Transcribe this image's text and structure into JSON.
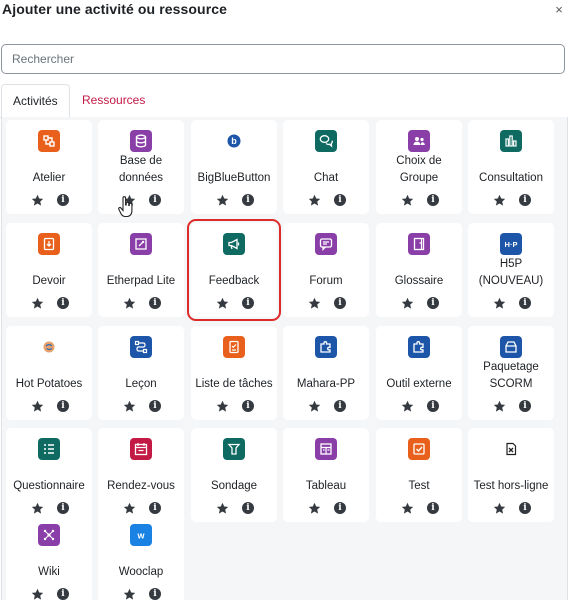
{
  "dialog": {
    "title": "Ajouter une activité ou ressource",
    "close_glyph": "×"
  },
  "search": {
    "placeholder": "Rechercher",
    "value": ""
  },
  "tabs": [
    {
      "label": "Activités",
      "active": true
    },
    {
      "label": "Ressources",
      "active": false
    }
  ],
  "colors": {
    "collaboration": "#f7634d",
    "communication": "#11a676",
    "assessment": "#eb66a2",
    "content": "#399be2",
    "interactive": "#7a5ae6",
    "teal": "#0d5d6f",
    "purple": "#8d3ab1",
    "blue": "#1a5bb3",
    "orange": "#e85a1d",
    "crimson": "#c31a45"
  },
  "activities": [
    {
      "name": "Atelier",
      "icon": "workshop-icon",
      "color": "#e8601c"
    },
    {
      "name": "Base de données",
      "icon": "database-icon",
      "color": "#8a3fa8"
    },
    {
      "name": "BigBlueButton",
      "icon": "bigbluebutton-icon",
      "color": "#1d56a8"
    },
    {
      "name": "Chat",
      "icon": "chat-icon",
      "color": "#0f6a62"
    },
    {
      "name": "Choix de Groupe",
      "icon": "group-choice-icon",
      "color": "#8a3fa8"
    },
    {
      "name": "Consultation",
      "icon": "poll-chart-icon",
      "color": "#0f6a62"
    },
    {
      "name": "Devoir",
      "icon": "assignment-icon",
      "color": "#e8601c"
    },
    {
      "name": "Etherpad Lite",
      "icon": "etherpad-icon",
      "color": "#8a3fa8"
    },
    {
      "name": "Feedback",
      "icon": "megaphone-icon",
      "color": "#0f6a62"
    },
    {
      "name": "Forum",
      "icon": "forum-icon",
      "color": "#8a3fa8"
    },
    {
      "name": "Glossaire",
      "icon": "glossary-icon",
      "color": "#8a3fa8"
    },
    {
      "name": "H5P (NOUVEAU)",
      "icon": "h5p-icon",
      "color": "#1d56a8"
    },
    {
      "name": "Hot Potatoes",
      "icon": "hot-potatoes-icon",
      "color": "#ffffff"
    },
    {
      "name": "Leçon",
      "icon": "lesson-icon",
      "color": "#1d56a8"
    },
    {
      "name": "Liste de tâches",
      "icon": "checklist-icon",
      "color": "#e8601c"
    },
    {
      "name": "Mahara-PP",
      "icon": "puzzle-icon",
      "color": "#1d56a8"
    },
    {
      "name": "Outil externe",
      "icon": "external-tool-icon",
      "color": "#1d56a8"
    },
    {
      "name": "Paquetage SCORM",
      "icon": "scorm-package-icon",
      "color": "#1d56a8"
    },
    {
      "name": "Questionnaire",
      "icon": "questionnaire-icon",
      "color": "#0f6a62"
    },
    {
      "name": "Rendez-vous",
      "icon": "scheduler-icon",
      "color": "#c31a45"
    },
    {
      "name": "Sondage",
      "icon": "survey-icon",
      "color": "#0f6a62"
    },
    {
      "name": "Tableau",
      "icon": "board-icon",
      "color": "#8a3fa8"
    },
    {
      "name": "Test",
      "icon": "quiz-icon",
      "color": "#e8601c"
    },
    {
      "name": "Test hors-ligne",
      "icon": "offline-quiz-icon",
      "color": "#ffffff"
    },
    {
      "name": "Wiki",
      "icon": "wiki-icon",
      "color": "#8a3fa8"
    },
    {
      "name": "Wooclap",
      "icon": "wooclap-icon",
      "color": "#1a82e2"
    }
  ],
  "card_actions": {
    "star_icon": "star-icon",
    "info_glyph": "i"
  },
  "highlighted": "Feedback"
}
